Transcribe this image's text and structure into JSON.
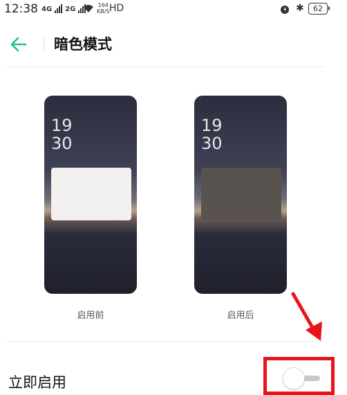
{
  "status_bar": {
    "time": "12:38",
    "network_1": "4G",
    "network_2": "2G",
    "speed_value": "164",
    "speed_unit": "KB/S",
    "hd": "HD",
    "battery": "62"
  },
  "header": {
    "title": "暗色模式",
    "back_icon": "back-arrow-icon",
    "accent": "#1fbf8f"
  },
  "previews": {
    "before": {
      "time_hour": "19",
      "time_min": "30",
      "caption": "启用前"
    },
    "after": {
      "time_hour": "19",
      "time_min": "30",
      "caption": "启用后"
    }
  },
  "settings": {
    "enable_now_label": "立即启用",
    "enable_now_on": false
  },
  "annotation": {
    "color": "#e8141b"
  }
}
